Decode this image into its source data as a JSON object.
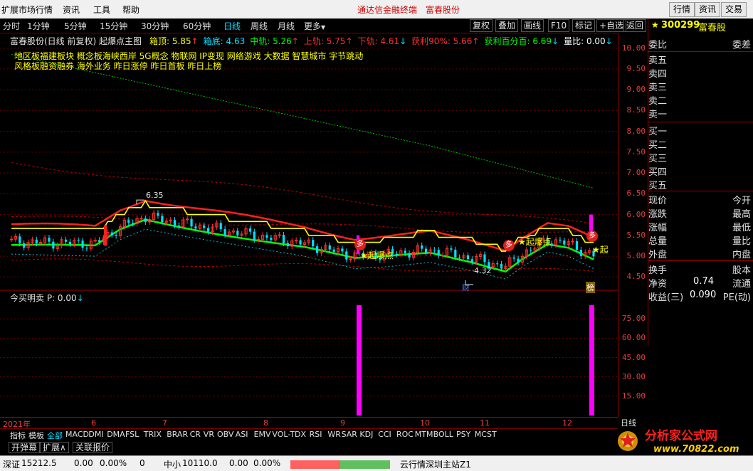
{
  "menubar": {
    "items": [
      "扩展市场行情",
      "资讯",
      "工具",
      "帮助"
    ],
    "promo": [
      "通达信金融终端",
      "富春股份"
    ],
    "right_buttons": [
      "行情",
      "资讯",
      "交易"
    ]
  },
  "periods": [
    "分时",
    "1分钟",
    "5分钟",
    "15分钟",
    "30分钟",
    "60分钟",
    "日线",
    "周线",
    "月线",
    "更多"
  ],
  "active_period": "日线",
  "more_arrow": "▼",
  "toolbar": [
    "复权",
    "叠加",
    "画线",
    "F10",
    "标记",
    "+自选",
    "返回"
  ],
  "stock": {
    "code": "300299",
    "name": "富春股"
  },
  "chart": {
    "title": "富春股份(日线 前复权) 起爆点主图",
    "top_line": [
      {
        "label": "箱顶: ",
        "value": "5.85",
        "arrow": "↑",
        "color": "#ffff00"
      },
      {
        "label": "箱底: ",
        "value": "4.63",
        "arrow": "",
        "color": "#00e0ff"
      },
      {
        "label": "中轨: ",
        "value": "5.26",
        "arrow": "↑",
        "color": "#00ff00"
      },
      {
        "label": "上轨: ",
        "value": "5.75",
        "arrow": "↑",
        "color": "#ff3030"
      },
      {
        "label": "下轨: ",
        "value": "4.61",
        "arrow": "↓",
        "color": "#ff3030"
      },
      {
        "label": "获利90%: ",
        "value": "5.66",
        "arrow": "↑",
        "color": "#ff3030"
      },
      {
        "label": "获利百分百: ",
        "value": "6.69",
        "arrow": "↓",
        "color": "#00ff00"
      },
      {
        "label": "量比: ",
        "value": "0.00",
        "arrow": "↓",
        "color": "#ffffff"
      },
      {
        "label": "起",
        "value": "",
        "arrow": "",
        "color": "#ff00ff"
      }
    ],
    "concept_line1": "地区板福建板块 概念板海峡西岸 5G概念 物联网 IP变现 网络游戏 大数据 智慧城市 字节跳动",
    "concept_line2": "风格板融资融券 海外业务 昨日涨停 昨日首板 昨日上榜",
    "annotations": {
      "high": "6.35",
      "low": "4.32",
      "signal": "起爆点",
      "signal_short": "起",
      "badge": "多",
      "marker_cai": "财",
      "marker_bang": "榜"
    },
    "y_axis": [
      "10.00",
      "9.50",
      "9.00",
      "8.50",
      "8.00",
      "7.50",
      "7.00",
      "6.50",
      "6.00",
      "5.50",
      "5.00",
      "4.50"
    ],
    "sub_title": "今买明卖  P: 0.00",
    "sub_arrow": "↓",
    "sub_axis": [
      "75.00",
      "60.00",
      "45.00",
      "30.00",
      "15.00"
    ],
    "dates": [
      "2021年",
      "6",
      "7",
      "8",
      "9",
      "10",
      "11",
      "12"
    ],
    "timeframe_label": "日线"
  },
  "chart_data": {
    "type": "candlestick",
    "ylim": [
      4.3,
      10.2
    ],
    "y_ticks": [
      4.5,
      5.0,
      5.5,
      6.0,
      6.5,
      7.0,
      7.5,
      8.0,
      8.5,
      9.0,
      9.5,
      10.0
    ],
    "box_top": 5.85,
    "box_bottom": 4.63,
    "middle_band": 5.26,
    "upper_band": 5.75,
    "lower_band": 4.61,
    "profit_90": 5.66,
    "profit_100": 6.69,
    "high_mark": 6.35,
    "low_mark": 4.32,
    "sub_indicator": {
      "name": "今买明卖",
      "P": 0.0,
      "ylim": [
        0,
        90
      ]
    }
  },
  "right_panel": {
    "header_left": "委比",
    "header_right": "委差",
    "sell": [
      "卖五",
      "卖四",
      "卖三",
      "卖二",
      "卖一"
    ],
    "buy": [
      "买一",
      "买二",
      "买三",
      "买四",
      "买五"
    ],
    "stats": [
      {
        "l": "现价",
        "r": "今开"
      },
      {
        "l": "涨跌",
        "r": "最高"
      },
      {
        "l": "涨幅",
        "r": "最低"
      },
      {
        "l": "总量",
        "r": "量比"
      },
      {
        "l": "外盘",
        "r": "内盘"
      }
    ],
    "stats2": [
      {
        "l": "换手",
        "v": "",
        "r": "股本"
      },
      {
        "l": "净资",
        "v": "0.74",
        "r": "流通"
      },
      {
        "l": "收益(三)",
        "v": "0.090",
        "r": "PE(动)"
      }
    ]
  },
  "indicators": [
    "指标",
    "模板",
    "全部",
    "MACD",
    "DMI",
    "DMA",
    "FSL",
    "TRIX",
    "BRAR",
    "CR",
    "VR",
    "OBV",
    "ASI",
    "EMV",
    "VOL-TDX",
    "RSI",
    "WR",
    "SAR",
    "KDJ",
    "CCI",
    "ROC",
    "MTM",
    "BOLL",
    "PSY",
    "MCST"
  ],
  "active_indicator": "全部",
  "bottom_buttons": [
    "开弹幕",
    "扩展∧",
    "关联报价"
  ],
  "status": {
    "sz_label": "深证",
    "sz_value": "15212.5",
    "sz_change": "0.00",
    "sz_pct": "0.00%",
    "sz_vol": "0",
    "zx_label": "中小",
    "zx_value": "10110.0",
    "zx_change": "0.00",
    "zx_pct": "0.00%",
    "server": "云行情深圳主站Z1"
  },
  "logo": {
    "text": "分析家公式网",
    "url": "www.70822.com"
  },
  "colors": {
    "bg": "#000000",
    "up": "#ff3030",
    "down": "#00e0ff",
    "grid": "#7a0000",
    "ma_green": "#00ff00",
    "ma_yellow": "#ffff00",
    "ma_red": "#ff2020",
    "magenta": "#ff00ff"
  }
}
